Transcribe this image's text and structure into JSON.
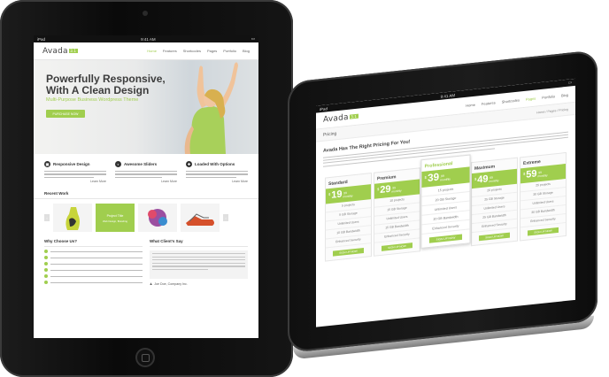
{
  "colors": {
    "accent": "#a0ce4e",
    "bezel": "#111111"
  },
  "device_portrait": {
    "status_bar": {
      "carrier": "iPad",
      "time": "9:41 AM"
    },
    "logo": {
      "name": "Avada",
      "badge": "3.1"
    },
    "nav": [
      "Home",
      "Features",
      "Shortcodes",
      "Pages",
      "Portfolio",
      "Blog"
    ],
    "hero": {
      "title_line1": "Powerfully Responsive,",
      "title_line2": "With A Clean Design",
      "subtitle": "Multi-Purpose Business Wordpress Theme",
      "button": "PURCHASE NOW"
    },
    "features": [
      {
        "title": "Responsive Design",
        "icon": "devices-icon",
        "link": "Learn More"
      },
      {
        "title": "Awesome Sliders",
        "icon": "sliders-icon",
        "link": "Learn More"
      },
      {
        "title": "Loaded With Options",
        "icon": "options-icon",
        "link": "Learn More"
      }
    ],
    "recent_work": {
      "title": "Recent Work",
      "project_caption": "Project Title",
      "project_sub": "Web Design, Branding"
    },
    "why_choose": {
      "title": "Why Choose Us?"
    },
    "client_say": {
      "title": "What Client's Say",
      "author": "Joe Doe, Company Inc."
    }
  },
  "device_landscape": {
    "status_bar": {
      "carrier": "iPad",
      "time": "9:41 AM"
    },
    "logo": {
      "name": "Avada",
      "badge": "3.1"
    },
    "nav": [
      "Home",
      "Features",
      "Shortcodes",
      "Pages",
      "Portfolio",
      "Blog"
    ],
    "page_title": "Pricing",
    "breadcrumb": "Home / Pages / Pricing",
    "heading": "Avada Has The Right Pricing For You!",
    "plans": [
      {
        "name": "Standard",
        "currency": "$",
        "price": "19",
        "cents": ".99",
        "period": "monthly",
        "features": [
          "5 projects",
          "5 GB Storage",
          "Unlimited Users",
          "10 GB Bandwidth",
          "Enhanced Security"
        ],
        "button": "SIGN UP NOW"
      },
      {
        "name": "Premium",
        "currency": "$",
        "price": "29",
        "cents": ".99",
        "period": "monthly",
        "features": [
          "10 projects",
          "15 GB Storage",
          "Unlimited Users",
          "15 GB Bandwidth",
          "Enhanced Security"
        ],
        "button": "SIGN UP NOW"
      },
      {
        "name": "Professional",
        "currency": "$",
        "price": "39",
        "cents": ".99",
        "period": "monthly",
        "features": [
          "15 projects",
          "20 GB Storage",
          "Unlimited Users",
          "20 GB Bandwidth",
          "Enhanced Security"
        ],
        "button": "SIGN UP NOW"
      },
      {
        "name": "Maximum",
        "currency": "$",
        "price": "49",
        "cents": ".99",
        "period": "monthly",
        "features": [
          "20 projects",
          "25 GB Storage",
          "Unlimited Users",
          "25 GB Bandwidth",
          "Enhanced Security"
        ],
        "button": "SIGN UP NOW"
      },
      {
        "name": "Extreme",
        "currency": "$",
        "price": "59",
        "cents": ".99",
        "period": "monthly",
        "features": [
          "25 projects",
          "30 GB Storage",
          "Unlimited Users",
          "30 GB Bandwidth",
          "Enhanced Security"
        ],
        "button": "SIGN UP NOW"
      }
    ]
  }
}
